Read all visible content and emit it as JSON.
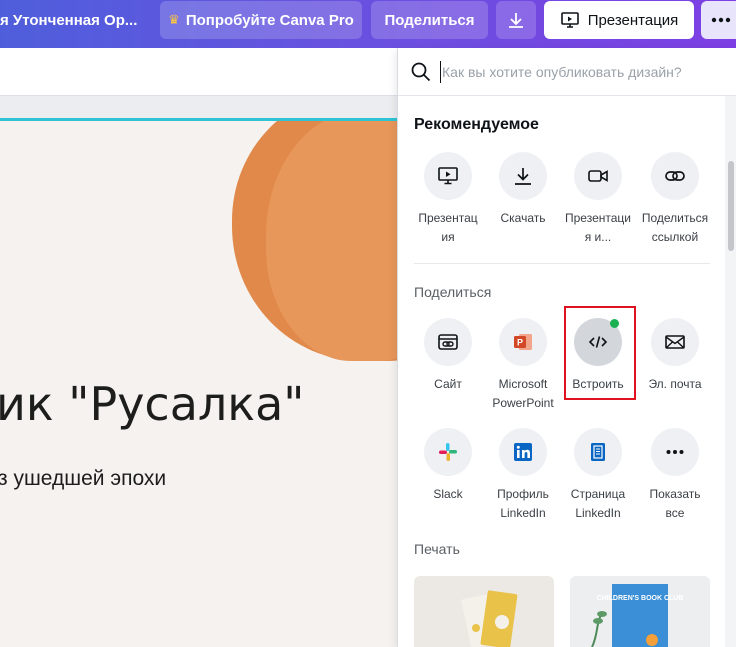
{
  "topbar": {
    "doc_title": "я Утонченная Ор...",
    "try_pro": "Попробуйте Canva Pro",
    "share": "Поделиться",
    "present": "Презентация"
  },
  "canvas": {
    "headline": "ик \"Русалка\"",
    "subline": "з ушедшей эпохи"
  },
  "panel": {
    "search_placeholder": "Как вы хотите опубликовать дизайн?",
    "recommended_title": "Рекомендуемое",
    "recommended": [
      {
        "label1": "Презентац",
        "label2": "ия",
        "icon": "presentation-icon"
      },
      {
        "label1": "Скачать",
        "label2": "",
        "icon": "download-icon"
      },
      {
        "label1": "Презентаци",
        "label2": "я и...",
        "icon": "video-icon"
      },
      {
        "label1": "Поделиться",
        "label2": "ссылкой",
        "icon": "link-icon"
      }
    ],
    "share_title": "Поделиться",
    "share_row1": [
      {
        "label1": "Сайт",
        "label2": "",
        "icon": "website-icon"
      },
      {
        "label1": "Microsoft",
        "label2": "PowerPoint",
        "icon": "powerpoint-icon"
      },
      {
        "label1": "Встроить",
        "label2": "",
        "icon": "embed-icon"
      },
      {
        "label1": "Эл. почта",
        "label2": "",
        "icon": "email-icon"
      }
    ],
    "share_row2": [
      {
        "label1": "Slack",
        "label2": "",
        "icon": "slack-icon"
      },
      {
        "label1": "Профиль",
        "label2": "LinkedIn",
        "icon": "linkedin-icon"
      },
      {
        "label1": "Страница",
        "label2": "LinkedIn",
        "icon": "linkedin-page-icon"
      },
      {
        "label1": "Показать",
        "label2": "все",
        "icon": "more-icon"
      }
    ],
    "print_title": "Печать",
    "print_card_text": "CHILDREN'S BOOK CLUB"
  },
  "colors": {
    "accent": "#2ec4d6",
    "highlight": "#e0121f",
    "online_dot": "#1bb152",
    "blob": "#e0894a"
  }
}
